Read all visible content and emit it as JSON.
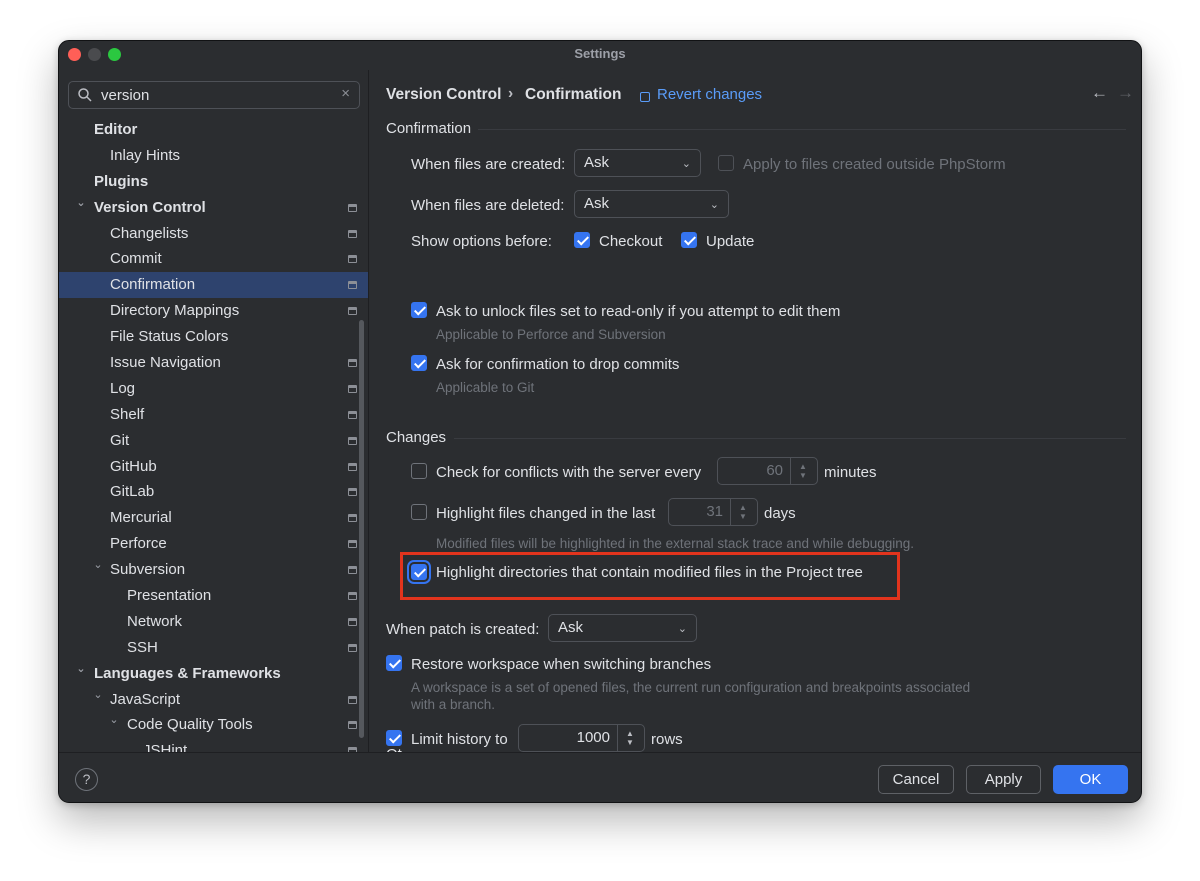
{
  "window": {
    "title": "Settings"
  },
  "search": {
    "value": "version",
    "clear_glyph": "×",
    "icon": "search-icon"
  },
  "sidebar": {
    "items": [
      {
        "label": "Editor",
        "level": 0,
        "bold": true,
        "chevron": "",
        "proj": false
      },
      {
        "label": "Inlay Hints",
        "level": 1,
        "bold": false,
        "chevron": "",
        "proj": false
      },
      {
        "label": "Plugins",
        "level": 0,
        "bold": true,
        "chevron": "",
        "proj": false
      },
      {
        "label": "Version Control",
        "level": 0,
        "bold": true,
        "chevron": "⌄",
        "proj": true
      },
      {
        "label": "Changelists",
        "level": 1,
        "bold": false,
        "chevron": "",
        "proj": true
      },
      {
        "label": "Commit",
        "level": 1,
        "bold": false,
        "chevron": "",
        "proj": true
      },
      {
        "label": "Confirmation",
        "level": 1,
        "bold": false,
        "chevron": "",
        "proj": true,
        "selected": true
      },
      {
        "label": "Directory Mappings",
        "level": 1,
        "bold": false,
        "chevron": "",
        "proj": true
      },
      {
        "label": "File Status Colors",
        "level": 1,
        "bold": false,
        "chevron": "",
        "proj": false
      },
      {
        "label": "Issue Navigation",
        "level": 1,
        "bold": false,
        "chevron": "",
        "proj": true
      },
      {
        "label": "Log",
        "level": 1,
        "bold": false,
        "chevron": "",
        "proj": true
      },
      {
        "label": "Shelf",
        "level": 1,
        "bold": false,
        "chevron": "",
        "proj": true
      },
      {
        "label": "Git",
        "level": 1,
        "bold": false,
        "chevron": "",
        "proj": true
      },
      {
        "label": "GitHub",
        "level": 1,
        "bold": false,
        "chevron": "",
        "proj": true
      },
      {
        "label": "GitLab",
        "level": 1,
        "bold": false,
        "chevron": "",
        "proj": true
      },
      {
        "label": "Mercurial",
        "level": 1,
        "bold": false,
        "chevron": "",
        "proj": true
      },
      {
        "label": "Perforce",
        "level": 1,
        "bold": false,
        "chevron": "",
        "proj": true
      },
      {
        "label": "Subversion",
        "level": 1,
        "bold": false,
        "chevron": "⌄",
        "proj": true
      },
      {
        "label": "Presentation",
        "level": 2,
        "bold": false,
        "chevron": "",
        "proj": true
      },
      {
        "label": "Network",
        "level": 2,
        "bold": false,
        "chevron": "",
        "proj": true
      },
      {
        "label": "SSH",
        "level": 2,
        "bold": false,
        "chevron": "",
        "proj": true
      },
      {
        "label": "Languages & Frameworks",
        "level": 0,
        "bold": true,
        "chevron": "⌄",
        "proj": false
      },
      {
        "label": "JavaScript",
        "level": 1,
        "bold": false,
        "chevron": "⌄",
        "proj": true
      },
      {
        "label": "Code Quality Tools",
        "level": 2,
        "bold": false,
        "chevron": "⌄",
        "proj": true
      },
      {
        "label": "JSHint",
        "level": 3,
        "bold": false,
        "chevron": "",
        "proj": true
      }
    ]
  },
  "header": {
    "crumb_parent": "Version Control",
    "crumb_sep": "›",
    "crumb_current": "Confirmation",
    "revert": "Revert changes",
    "back_glyph": "←",
    "forward_glyph": "→"
  },
  "confirmation": {
    "title": "Confirmation",
    "created_label": "When files are created:",
    "created_value": "Ask",
    "apply_outside_label": "Apply to files created outside PhpStorm",
    "deleted_label": "When files are deleted:",
    "deleted_value": "Ask",
    "show_options_label": "Show options before:",
    "checkout_label": "Checkout",
    "update_label": "Update",
    "unlock_label": "Ask to unlock files set to read-only if you attempt to edit them",
    "unlock_hint": "Applicable to Perforce and Subversion",
    "drop_label": "Ask for confirmation to drop commits",
    "drop_hint": "Applicable to Git"
  },
  "changes": {
    "title": "Changes",
    "conflicts_label": "Check for conflicts with the server every",
    "conflicts_value": "60",
    "conflicts_unit": "minutes",
    "highlight_changed_label": "Highlight files changed in the last",
    "highlight_changed_value": "31",
    "highlight_changed_unit": "days",
    "highlight_changed_hint": "Modified files will be highlighted in the external stack trace and while debugging.",
    "highlight_dirs_label": "Highlight directories that contain modified files in the Project tree"
  },
  "misc": {
    "patch_label": "When patch is created:",
    "patch_value": "Ask",
    "restore_label": "Restore workspace when switching branches",
    "restore_hint": "A workspace is a set of opened files, the current run configuration and breakpoints associated with a branch.",
    "limit_label": "Limit history to",
    "limit_value": "1000",
    "limit_unit": "rows",
    "next_section_partial": "Ot"
  },
  "footer": {
    "help": "?",
    "cancel": "Cancel",
    "apply": "Apply",
    "ok": "OK"
  },
  "colors": {
    "accent": "#3574f0",
    "link": "#5a9cf8",
    "highlight_box": "#e2341d",
    "selection": "#2e436e"
  }
}
